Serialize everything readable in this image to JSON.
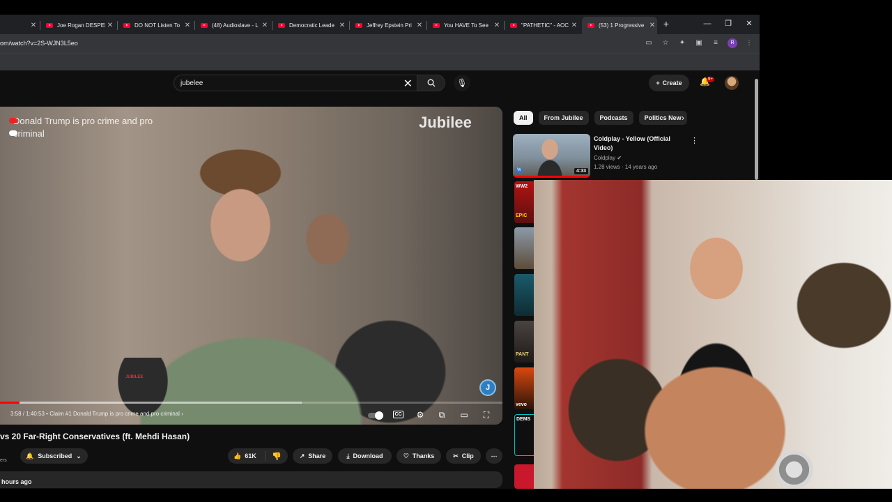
{
  "browser": {
    "tabs": [
      {
        "title": "Joe Rogan DESPER"
      },
      {
        "title": "DO NOT Listen To"
      },
      {
        "title": "(48) Audioslave - L"
      },
      {
        "title": "Democratic Leade"
      },
      {
        "title": "Jeffrey Epstein Pri"
      },
      {
        "title": "You HAVE To See"
      },
      {
        "title": "\"PATHETIC\" - AOC"
      },
      {
        "title": "(53) 1 Progressive"
      }
    ],
    "url": "om/watch?v=2S-WJN3L5eo",
    "profile_initial": "R"
  },
  "youtube": {
    "search": {
      "query": "jubelee"
    },
    "create_label": "Create",
    "notification_count": "9+",
    "player": {
      "overlay_text": "Donald Trump is pro crime and pro criminal",
      "watermark": "Jubilee",
      "badge_letter": "J",
      "mic_label": "JUBILEE",
      "time": "3:58 / 1:40:53",
      "chapter": "• Claim #1 Donald Trump is pro crime and pro criminal",
      "chapter_arrow": "›",
      "progress_fraction": 0.0394,
      "buffered_fraction": 0.6
    },
    "video": {
      "title_fragment": "vs 20 Far-Right Conservatives (ft. Mehdi Hasan)",
      "subs_fragment": "ers",
      "subscribed_label": "Subscribed",
      "likes": "61K",
      "share_label": "Share",
      "download_label": "Download",
      "thanks_label": "Thanks",
      "clip_label": "Clip",
      "posted_fragment": "hours ago"
    },
    "chips": [
      "All",
      "From Jubilee",
      "Podcasts",
      "Politics New"
    ],
    "recommendation": {
      "title": "Coldplay - Yellow (Official Video)",
      "channel": "Coldplay",
      "meta": "1.28 views · 14 years ago",
      "duration": "4:33",
      "logo_letter": "W"
    },
    "side_thumb_labels": [
      "WW2",
      "EPIC",
      "PANT",
      "vevo",
      "DEMS"
    ]
  },
  "colors": {
    "accent_red": "#ff0000",
    "youtube_bg": "#0f0f0f",
    "chip_bg": "#272727"
  }
}
